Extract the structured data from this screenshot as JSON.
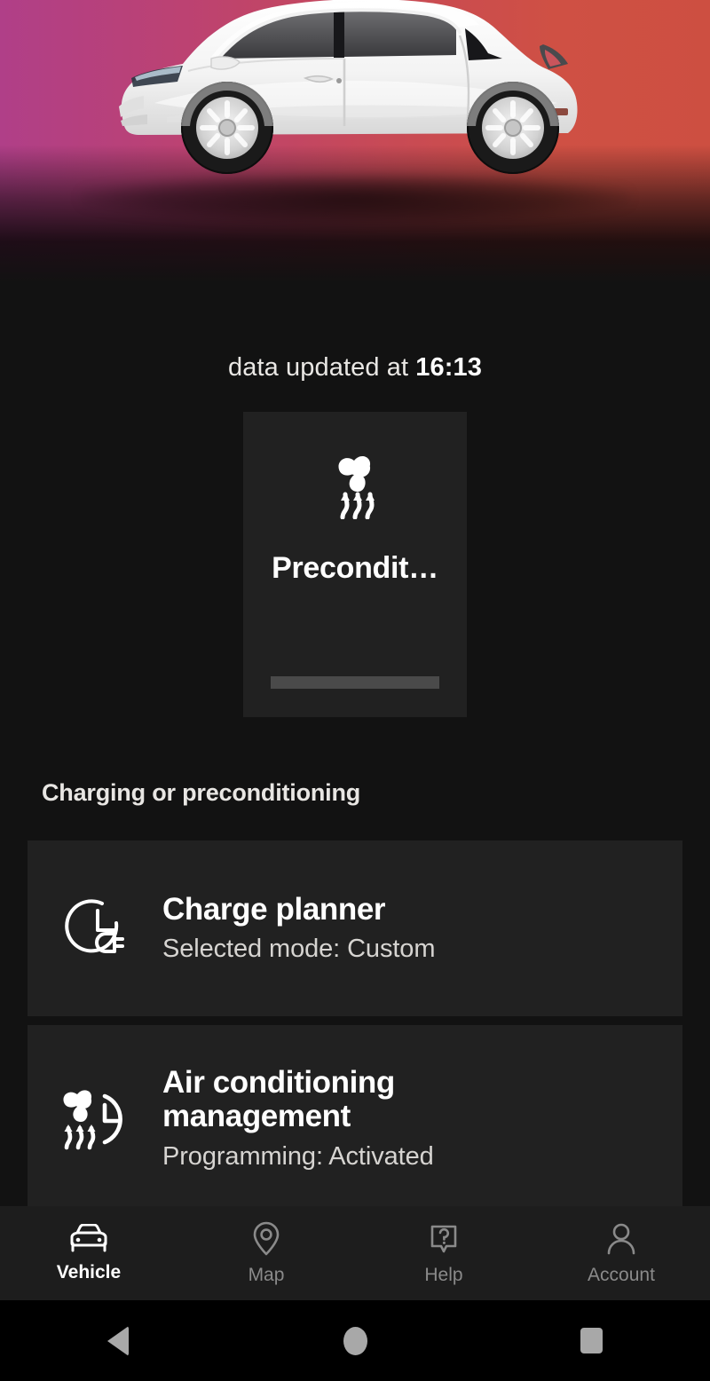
{
  "hero": {
    "vehicle_image_name": "white-electric-hatchback-side-view",
    "gradient_left_color": "#b03f88",
    "gradient_right_color": "#cd4f41",
    "background_color": "#121212"
  },
  "status": {
    "updated_prefix": "data updated at ",
    "updated_time": "16:13"
  },
  "precondition_tile": {
    "icon": "fan-heat-waves-icon",
    "title": "Precondit…",
    "progress_bar_color": "#4a4a4a",
    "tile_background": "#212121"
  },
  "section": {
    "title": "Charging or preconditioning"
  },
  "cards": [
    {
      "icon": "clock-plug-icon",
      "title": "Charge planner",
      "subtitle": "Selected mode: Custom"
    },
    {
      "icon": "fan-clock-icon",
      "title": "Air conditioning management",
      "subtitle": "Programming: Activated"
    }
  ],
  "tabbar": {
    "items": [
      {
        "label": "Vehicle",
        "icon": "car-front-icon",
        "active": true
      },
      {
        "label": "Map",
        "icon": "location-pin-icon",
        "active": false
      },
      {
        "label": "Help",
        "icon": "question-bubble-icon",
        "active": false
      },
      {
        "label": "Account",
        "icon": "person-icon",
        "active": false
      }
    ],
    "active_color": "#ffffff",
    "inactive_color": "#8a8a8a"
  },
  "system_nav": {
    "back": "back-triangle-icon",
    "home": "home-circle-icon",
    "recents": "recents-square-icon"
  }
}
